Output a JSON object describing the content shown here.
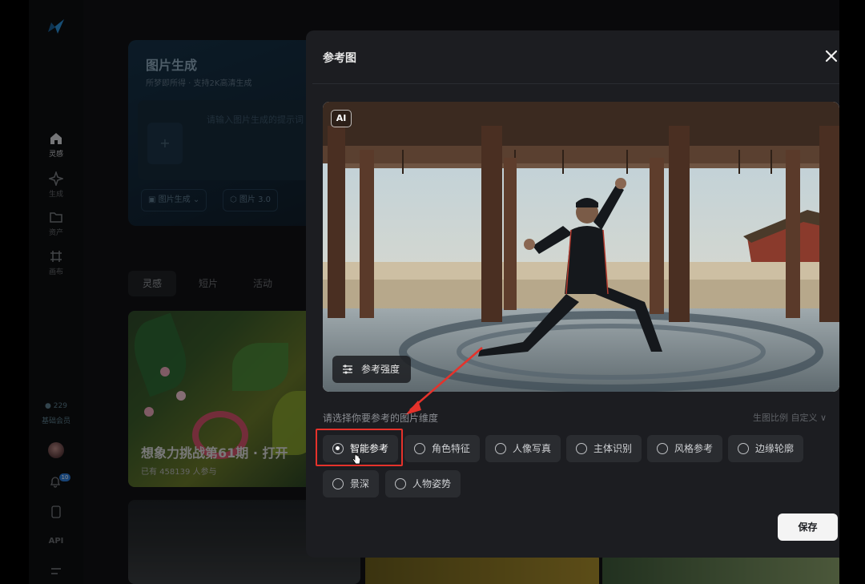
{
  "sidebar": {
    "items": [
      {
        "label": "灵感",
        "icon": "home-icon"
      },
      {
        "label": "生成",
        "icon": "sparkle-icon"
      },
      {
        "label": "资产",
        "icon": "folder-icon"
      },
      {
        "label": "画布",
        "icon": "canvas-icon"
      }
    ],
    "credits_value": "229",
    "credits_label": "基础会员",
    "notification_count": "10",
    "api_label": "API"
  },
  "background": {
    "gen_title": "图片生成",
    "gen_subtitle": "所梦即所得 · 支持2K高清生成",
    "gen_placeholder": "请输入图片生成的提示词",
    "gen_upload_plus": "+",
    "gen_mode_chip": "图片生成",
    "gen_model_chip": "图片 3.0",
    "tabs": [
      "灵感",
      "短片",
      "活动"
    ],
    "feed_title": "想象力挑战第61期 · 打开",
    "feed_sub": "已有 458139 人参与"
  },
  "modal": {
    "title": "参考图",
    "ai_badge": "AI",
    "strength_label": "参考强度",
    "dimension_prompt": "请选择你要参考的图片维度",
    "ratio_label": "生图比例 自定义 ∨",
    "options": [
      {
        "label": "智能参考",
        "selected": true
      },
      {
        "label": "角色特征",
        "selected": false
      },
      {
        "label": "人像写真",
        "selected": false
      },
      {
        "label": "主体识别",
        "selected": false
      },
      {
        "label": "风格参考",
        "selected": false
      },
      {
        "label": "边缘轮廓",
        "selected": false
      },
      {
        "label": "景深",
        "selected": false
      },
      {
        "label": "人物姿势",
        "selected": false
      }
    ],
    "save_label": "保存"
  },
  "colors": {
    "accent_red": "#e5322b",
    "modal_bg": "#1c1d21",
    "option_bg": "#2a2c30"
  }
}
